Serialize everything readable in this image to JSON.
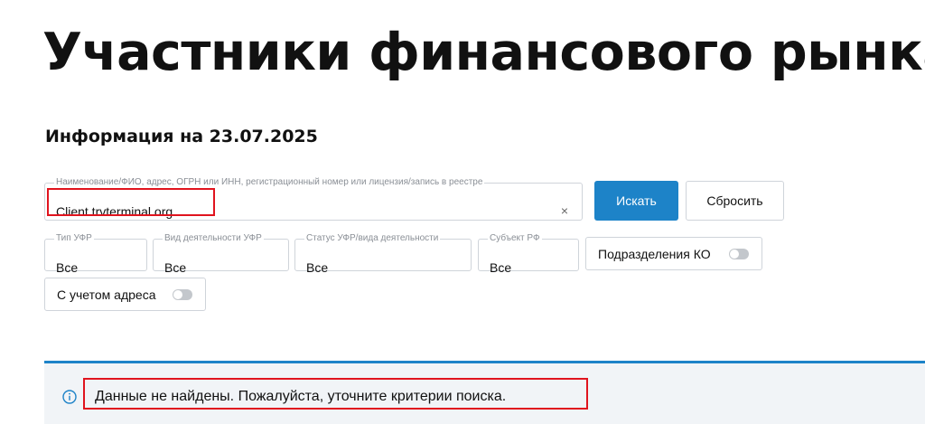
{
  "page": {
    "title": "Участники финансового рынка",
    "info_date": "Информация на 23.07.2025"
  },
  "search": {
    "label": "Наименование/ФИО, адрес, ОГРН или ИНН, регистрационный номер или лицензия/запись в реестре",
    "value": "Client.trvterminal.org",
    "clear_symbol": "×",
    "search_button": "Искать",
    "reset_button": "Сбросить"
  },
  "filters": {
    "type": {
      "label": "Тип УФР",
      "value": "Все"
    },
    "kind": {
      "label": "Вид деятельности УФР",
      "value": "Все"
    },
    "status": {
      "label": "Статус УФР/вида деятельности",
      "value": "Все"
    },
    "subject": {
      "label": "Субъект РФ",
      "value": "Все"
    },
    "ko_divisions": {
      "label": "Подразделения КО",
      "enabled": false
    },
    "with_address": {
      "label": "С учетом адреса",
      "enabled": false
    }
  },
  "alert": {
    "icon": "info-icon",
    "text": "Данные не найдены. Пожалуйста, уточните критерии поиска.",
    "accent_color": "#1d83c8"
  },
  "colors": {
    "primary": "#1d83c8",
    "highlight": "#e0141e"
  }
}
